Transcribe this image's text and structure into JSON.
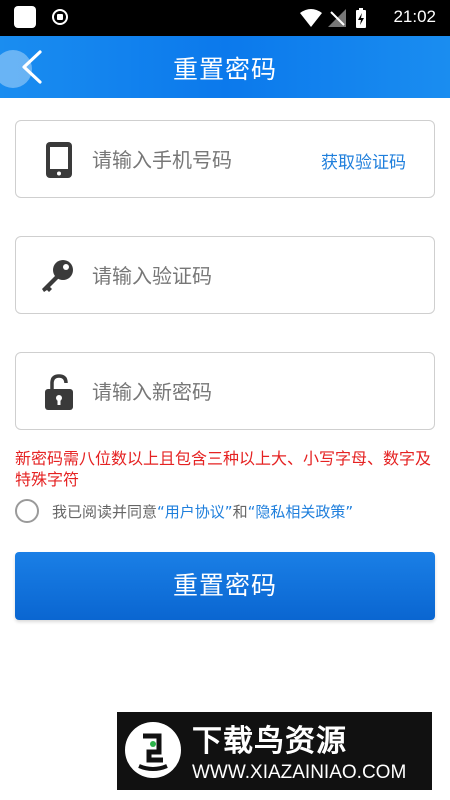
{
  "status_bar": {
    "time": "21:02"
  },
  "header": {
    "title": "重置密码"
  },
  "phone_field": {
    "placeholder": "请输入手机号码",
    "get_code_label": "获取验证码"
  },
  "code_field": {
    "placeholder": "请输入验证码"
  },
  "password_field": {
    "placeholder": "请输入新密码"
  },
  "password_rule": "新密码需八位数以上且包含三种以上大、小写字母、数字及特殊字符",
  "agreement": {
    "prefix": "我已阅读并同意",
    "user_agreement": "“用户协议”",
    "and": "和",
    "privacy_policy": "“隐私相关政策”"
  },
  "submit_label": "重置密码",
  "watermark": {
    "title": "下载鸟资源",
    "url": "WWW.XIAZAINIAO.COM"
  },
  "colors": {
    "accent": "#0b79ec",
    "link": "#1f7fdc",
    "warning": "#e52222"
  },
  "icons": [
    "phone-icon",
    "key-icon",
    "unlock-icon",
    "back-arrow-icon"
  ]
}
